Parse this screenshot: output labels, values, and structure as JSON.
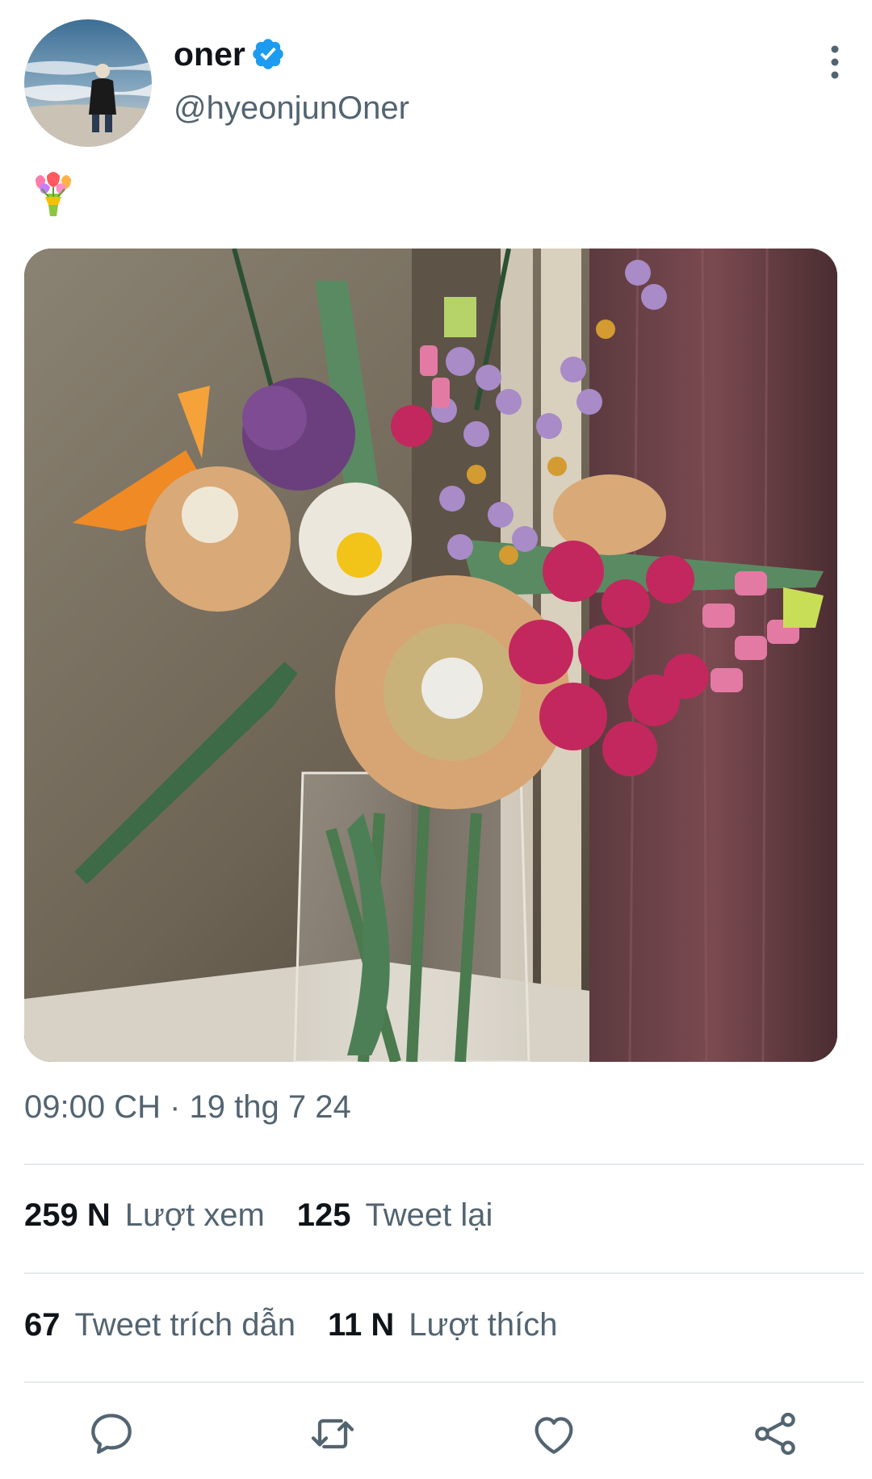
{
  "user": {
    "display_name": "oner",
    "handle": "@hyeonjunOner",
    "verified": true
  },
  "tweet": {
    "emoji_icon": "bouquet-emoji",
    "timestamp": "09:00 CH · 19 thg 7 24"
  },
  "stats": {
    "views_count": "259 N",
    "views_label": "Lượt xem",
    "retweets_count": "125",
    "retweets_label": "Tweet lại",
    "quotes_count": "67",
    "quotes_label": "Tweet trích dẫn",
    "likes_count": "11 N",
    "likes_label": "Lượt thích"
  },
  "actions": {
    "icons": [
      "reply-icon",
      "retweet-icon",
      "like-icon",
      "share-icon"
    ]
  },
  "colors": {
    "verified": "#1d9bf0",
    "secondary_text": "#536471",
    "primary_text": "#0f1419"
  }
}
